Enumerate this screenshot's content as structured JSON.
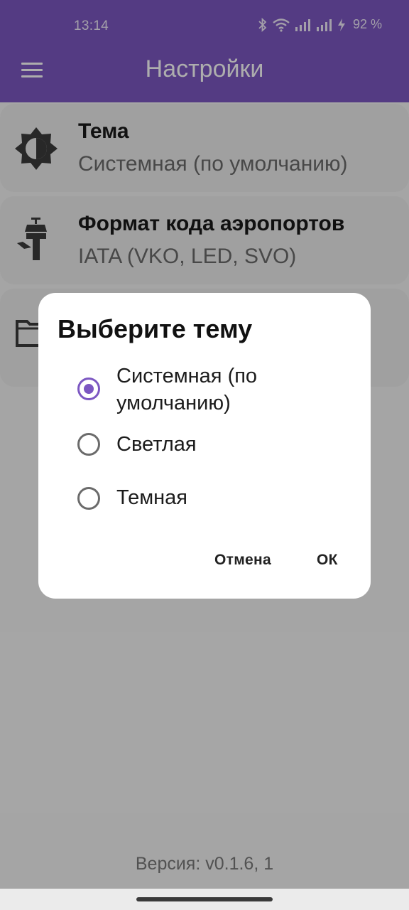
{
  "status_bar": {
    "time": "13:14",
    "battery": "92 %"
  },
  "app_bar": {
    "title": "Настройки",
    "menu_icon": "hamburger-menu-icon"
  },
  "settings": [
    {
      "icon": "theme-brightness-icon",
      "title": "Тема",
      "value": "Системная (по умолчанию)"
    },
    {
      "icon": "airport-tower-icon",
      "title": "Формат кода аэропортов",
      "value": "IATA (VKO, LED, SVO)"
    },
    {
      "icon": "folder-icon",
      "title": "",
      "value": ""
    }
  ],
  "version": "Версия: v0.1.6, 1",
  "dialog": {
    "title": "Выберите тему",
    "options": [
      {
        "label": "Системная (по умолчанию)",
        "selected": true
      },
      {
        "label": "Светлая",
        "selected": false
      },
      {
        "label": "Темная",
        "selected": false
      }
    ],
    "cancel_label": "Отмена",
    "ok_label": "ОК"
  },
  "colors": {
    "primary": "#7c57c2"
  }
}
